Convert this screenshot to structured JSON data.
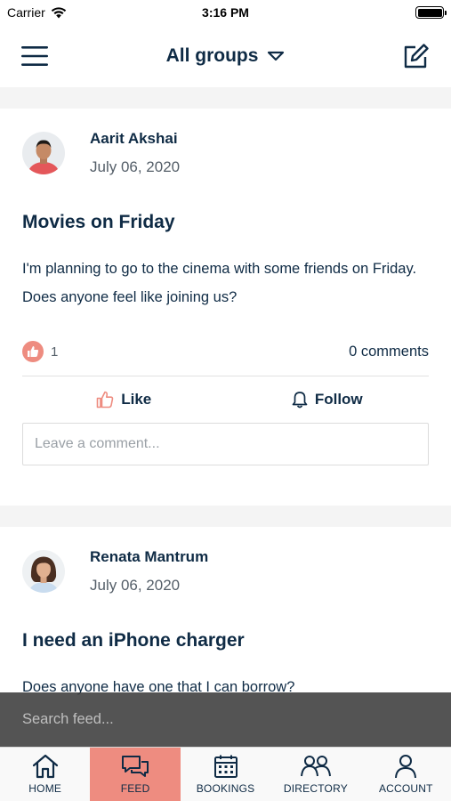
{
  "status_bar": {
    "carrier": "Carrier",
    "time": "3:16 PM"
  },
  "header": {
    "title": "All groups"
  },
  "posts": [
    {
      "author": "Aarit Akshai",
      "date": "July 06, 2020",
      "title": "Movies on Friday",
      "body": "I'm planning to go to the cinema with some friends on Friday. Does anyone feel like joining us?",
      "like_count": "1",
      "comments": "0 comments",
      "like_label": "Like",
      "follow_label": "Follow",
      "comment_placeholder": "Leave a comment..."
    },
    {
      "author": "Renata Mantrum",
      "date": "July 06, 2020",
      "title": "I need an iPhone charger",
      "body": "Does anyone have one that I can borrow?"
    }
  ],
  "search": {
    "placeholder": "Search feed..."
  },
  "tabs": [
    {
      "label": "HOME",
      "icon": "home-icon"
    },
    {
      "label": "FEED",
      "icon": "chat-bubbles-icon"
    },
    {
      "label": "BOOKINGS",
      "icon": "calendar-icon"
    },
    {
      "label": "DIRECTORY",
      "icon": "people-icon"
    },
    {
      "label": "ACCOUNT",
      "icon": "person-icon"
    }
  ],
  "active_tab": "FEED",
  "colors": {
    "accent": "#ee8c80",
    "text": "#0f2b45",
    "muted": "#555f69"
  }
}
